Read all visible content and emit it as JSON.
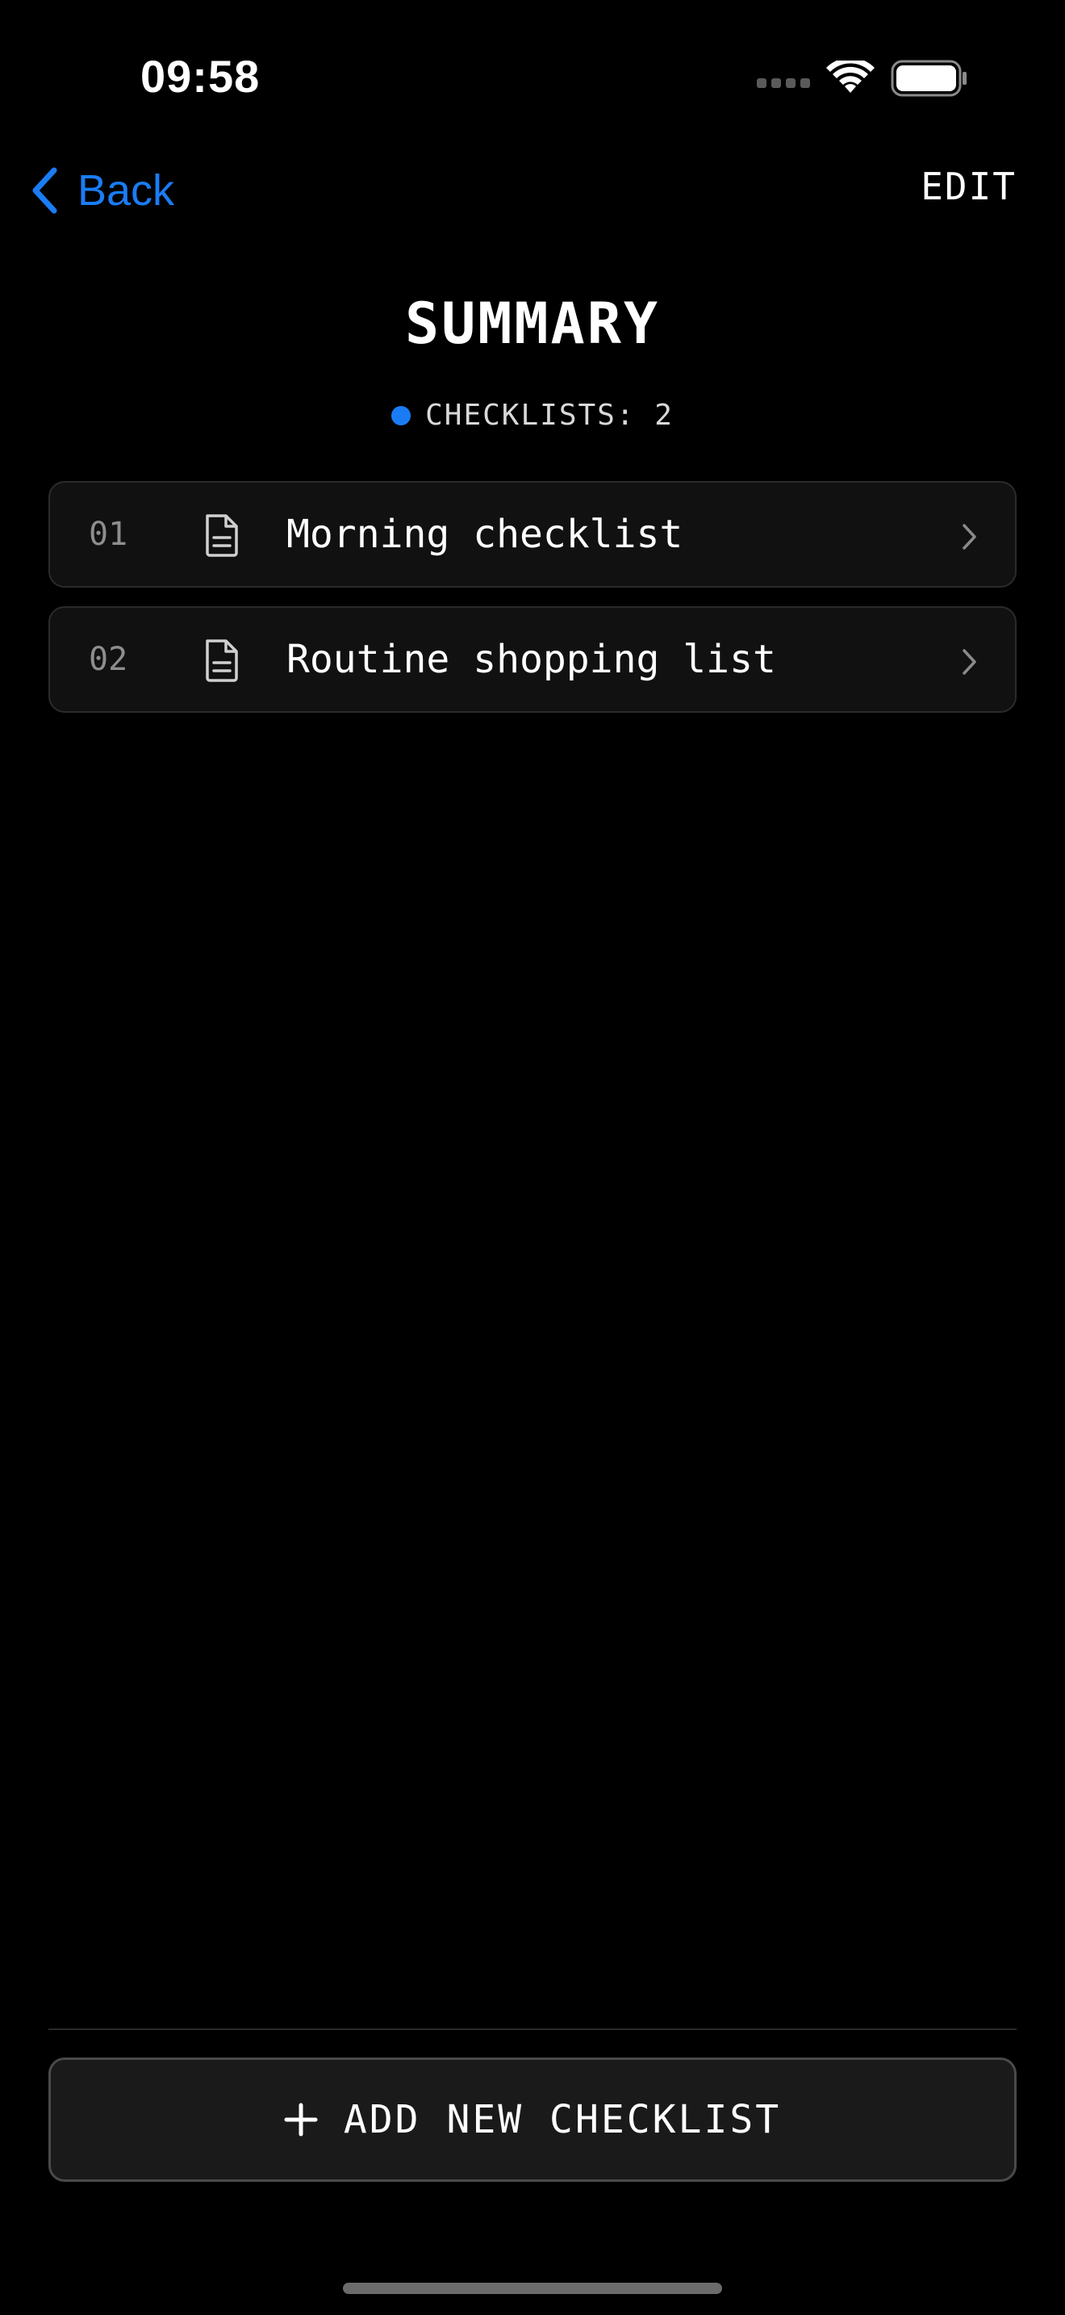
{
  "status_bar": {
    "time": "09:58",
    "icons": [
      "signal-dots-icon",
      "wifi-icon",
      "battery-icon"
    ]
  },
  "nav": {
    "back_label": "Back",
    "edit_label": "EDIT"
  },
  "header": {
    "title": "SUMMARY",
    "count_label": "CHECKLISTS: 2"
  },
  "checklists": [
    {
      "index": "01",
      "icon": "document-icon",
      "title": "Morning checklist"
    },
    {
      "index": "02",
      "icon": "document-icon",
      "title": "Routine shopping list"
    }
  ],
  "add_button": {
    "icon": "plus-icon",
    "label": "ADD NEW CHECKLIST"
  },
  "colors": {
    "background": "#000000",
    "accent": "#1a7cf5",
    "row_background": "#111111",
    "row_border": "#2b2b2b",
    "button_background": "#1a1a1a"
  }
}
